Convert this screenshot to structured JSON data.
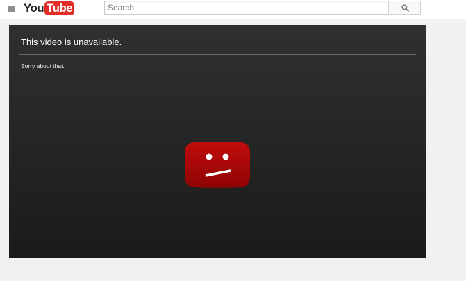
{
  "header": {
    "logo": {
      "you": "You",
      "tube": "Tube"
    },
    "search": {
      "placeholder": "Search",
      "value": ""
    },
    "icons": {
      "menu": "hamburger-menu-icon",
      "search": "magnifier-icon"
    }
  },
  "player": {
    "error_title": "This video is unavailable.",
    "error_subtitle": "Sorry about that.",
    "error_icon": "sad-tv-icon"
  },
  "colors": {
    "brand_red": "#e52d27",
    "sad_icon_red": "#b00808",
    "player_bg": "#262626",
    "page_bg": "#f1f1f1"
  }
}
